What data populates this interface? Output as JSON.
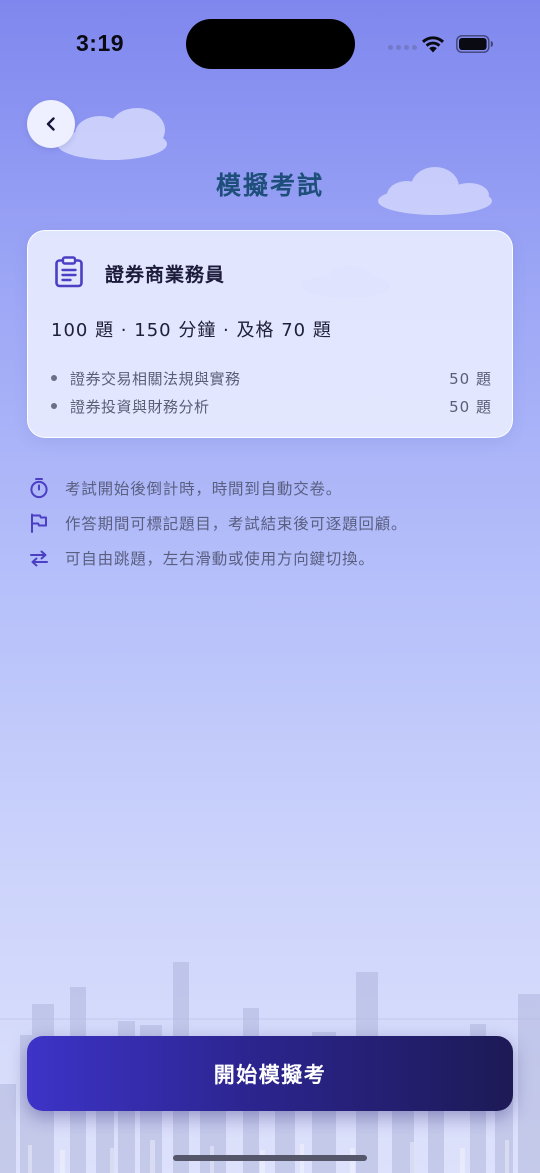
{
  "status_bar": {
    "time": "3:19"
  },
  "header": {
    "title": "模擬考試"
  },
  "exam": {
    "name": "證券商業務員",
    "summary": "100 題 · 150 分鐘 · 及格 70 題",
    "subjects": [
      {
        "name": "證券交易相關法規與實務",
        "count": "50 題"
      },
      {
        "name": "證券投資與財務分析",
        "count": "50 題"
      }
    ]
  },
  "info": [
    {
      "icon": "stopwatch-icon",
      "text": "考試開始後倒計時，時間到自動交卷。"
    },
    {
      "icon": "flag-icon",
      "text": "作答期間可標記題目，考試結束後可逐題回顧。"
    },
    {
      "icon": "swap-arrows-icon",
      "text": "可自由跳題，左右滑動或使用方向鍵切換。"
    }
  ],
  "actions": {
    "start_label": "開始模擬考"
  },
  "colors": {
    "accent": "#4b3fc4",
    "title": "#1e4e7a",
    "button_start": "#3d33c8",
    "button_end": "#1d1a56"
  }
}
